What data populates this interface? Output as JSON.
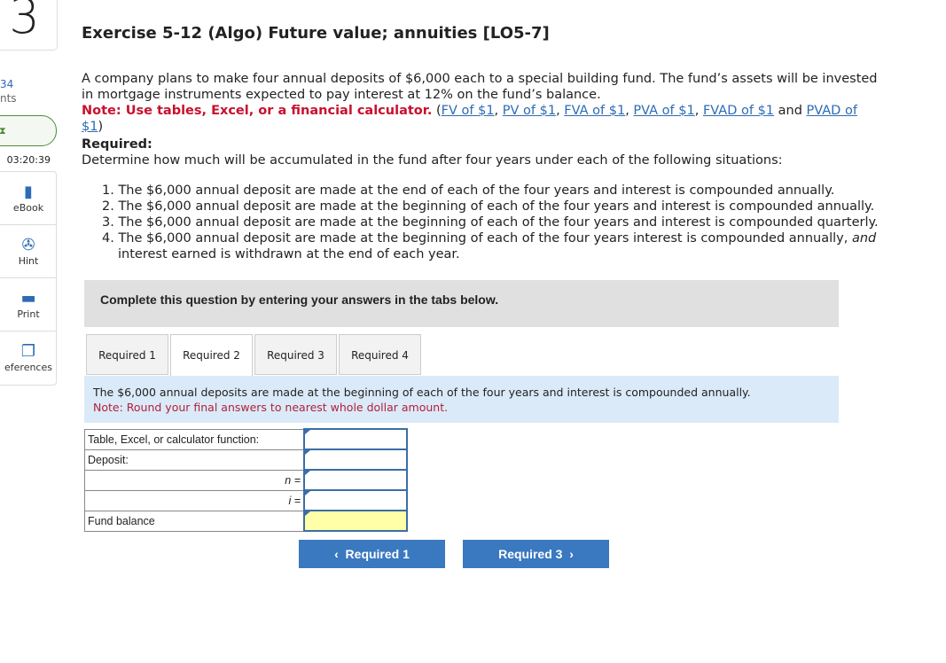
{
  "sidebar": {
    "question_number": "3",
    "points_value": "34",
    "points_label": "nts",
    "timer": "03:20:39",
    "tools": [
      {
        "label": "eBook",
        "icon": "book-icon"
      },
      {
        "label": "Hint",
        "icon": "lifebuoy-icon"
      },
      {
        "label": "Print",
        "icon": "printer-icon"
      },
      {
        "label": "eferences",
        "icon": "references-icon"
      }
    ]
  },
  "title": "Exercise 5-12 (Algo) Future value; annuities [LO5-7]",
  "intro": "A company plans to make four annual deposits of $6,000 each to a special building fund. The fund’s assets will be invested in mortgage instruments expected to pay interest at 12% on the fund’s balance.",
  "note_label": "Note: Use tables, Excel, or a financial calculator.",
  "links": [
    "FV of $1",
    "PV of $1",
    "FVA of $1",
    "PVA of $1",
    "FVAD of $1",
    "PVAD of $1"
  ],
  "link_and": "and",
  "required_heading": "Required:",
  "required_text": "Determine how much will be accumulated in the fund after four years under each of the following situations:",
  "list": [
    "1. The $6,000 annual deposit are made at the end of each of the four years  and interest is compounded annually.",
    "2. The $6,000 annual deposit are made at the beginning of each of the four years and interest is compounded annually.",
    "3. The $6,000 annual deposit are made at the beginning of each of the four years and interest is compounded quarterly."
  ],
  "item4_a": "4. The $6,000 annual deposit are made at the beginning of each of the four years interest is compounded annually, ",
  "item4_em": "and",
  "item4_b": " interest earned is withdrawn at the end of each year.",
  "instruction": "Complete this question by entering your answers in the tabs below.",
  "tabs": [
    "Required 1",
    "Required 2",
    "Required 3",
    "Required 4"
  ],
  "active_tab": "Required 2",
  "info": "The $6,000 annual deposits are made at the beginning of each of the four years and interest is compounded annually.",
  "info_note": "Note: Round your final answers to nearest whole dollar amount.",
  "table": {
    "rows": [
      {
        "label": "Table, Excel, or calculator function:",
        "value": ""
      },
      {
        "label": "Deposit:",
        "value": ""
      },
      {
        "label": "n =",
        "value": ""
      },
      {
        "label": "i =",
        "value": ""
      },
      {
        "label": "Fund balance",
        "value": ""
      }
    ]
  },
  "nav": {
    "prev": "Required 1",
    "next": "Required 3"
  },
  "colors": {
    "accent": "#3a78c0",
    "note_red": "#c8102e",
    "info_bg": "#dbeaf8",
    "answer_yellow": "#ffffa8"
  }
}
